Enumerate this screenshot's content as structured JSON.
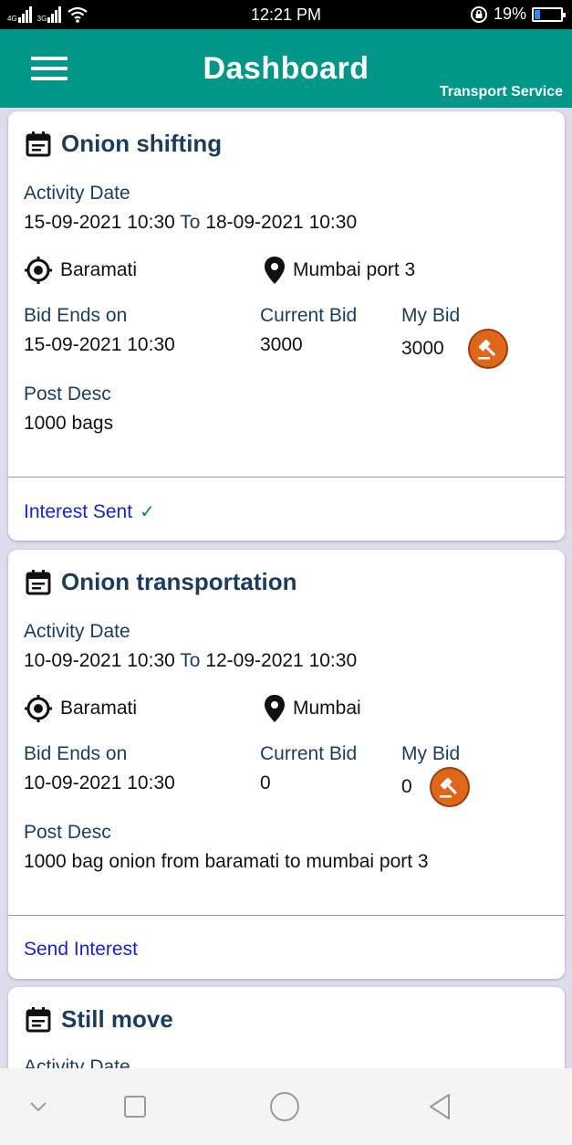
{
  "status_bar": {
    "network1": "4G",
    "network2": "3G",
    "time": "12:21 PM",
    "battery_percent": "19%",
    "battery_level": 0.19
  },
  "app_bar": {
    "title": "Dashboard",
    "subtitle": "Transport Service"
  },
  "cards": [
    {
      "title": "Onion shifting",
      "activity_date_label": "Activity Date",
      "date_from": "15-09-2021 10:30",
      "date_to_word": "To",
      "date_to": "18-09-2021 10:30",
      "origin": "Baramati",
      "destination": "Mumbai port 3",
      "bid_ends_label": "Bid Ends on",
      "bid_ends_value": "15-09-2021 10:30",
      "current_bid_label": "Current Bid",
      "current_bid_value": "3000",
      "my_bid_label": "My Bid",
      "my_bid_value": "3000",
      "post_desc_label": "Post Desc",
      "post_desc_value": "1000 bags",
      "action_label": "Interest Sent",
      "action_sent": true
    },
    {
      "title": "Onion transportation",
      "activity_date_label": "Activity Date",
      "date_from": "10-09-2021 10:30",
      "date_to_word": "To",
      "date_to": "12-09-2021 10:30",
      "origin": "Baramati",
      "destination": "Mumbai",
      "bid_ends_label": "Bid Ends on",
      "bid_ends_value": "10-09-2021 10:30",
      "current_bid_label": "Current Bid",
      "current_bid_value": "0",
      "my_bid_label": "My Bid",
      "my_bid_value": "0",
      "post_desc_label": "Post Desc",
      "post_desc_value": "1000 bag onion from baramati to mumbai port 3",
      "action_label": "Send Interest",
      "action_sent": false
    },
    {
      "title": "Still move",
      "activity_date_label": "Activity Date"
    }
  ],
  "colors": {
    "app_bar": "#009688",
    "heading": "#1c3c5c",
    "link": "#1a23c8",
    "gavel": "#e0661c",
    "check": "#1f8a2e"
  },
  "icons": {
    "menu": "menu-icon",
    "calendar": "calendar-icon",
    "origin": "gps-target-icon",
    "destination": "location-pin-icon",
    "bid": "gavel-icon",
    "sent": "check-icon"
  }
}
